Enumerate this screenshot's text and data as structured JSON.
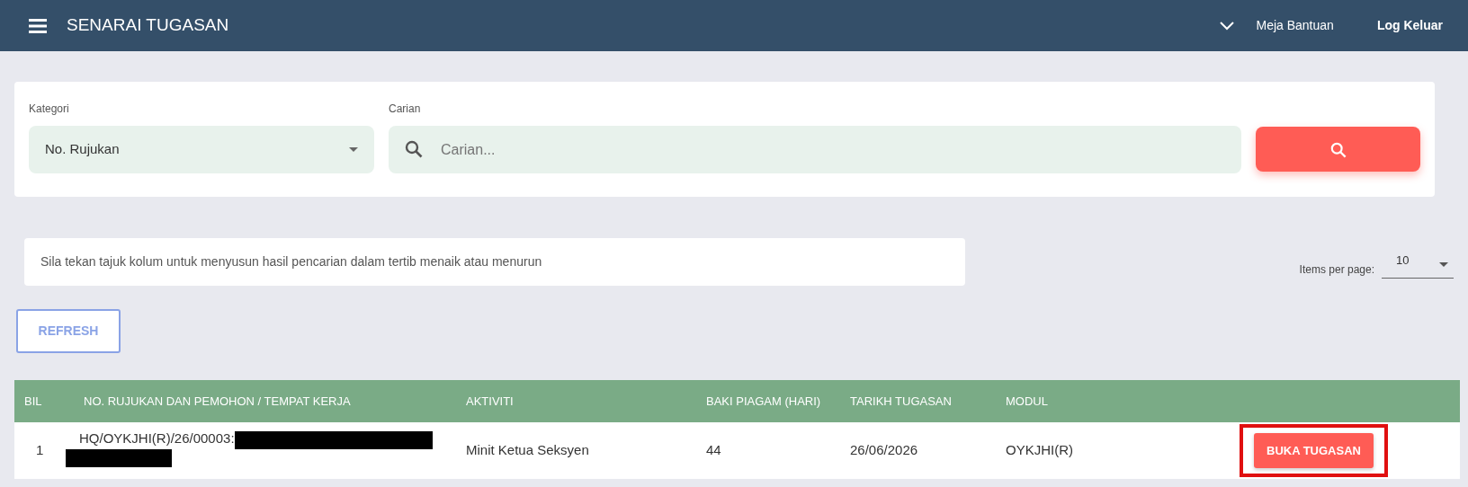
{
  "navbar": {
    "title": "SENARAI TUGASAN",
    "links": [
      "Meja Bantuan",
      "Log Keluar"
    ]
  },
  "filter": {
    "category_label": "Kategori",
    "category_value": "No. Rujukan",
    "search_label": "Carian",
    "search_placeholder": "Carian..."
  },
  "hint": "Sila tekan tajuk kolum untuk menyusun hasil pencarian dalam tertib menaik atau menurun",
  "items_per_page": {
    "label": "Items per page:",
    "value": "10"
  },
  "refresh_button": "REFRESH",
  "table": {
    "columns": [
      "BIL",
      "NO. RUJUKAN DAN PEMOHON / TEMPAT KERJA",
      "AKTIVITI",
      "BAKI PIAGAM (HARI)",
      "TARIKH TUGASAN",
      "MODUL"
    ],
    "rows": [
      {
        "bil": "1",
        "reference": "HQ/OYKJHI(R)/26/00003:",
        "redacted": true,
        "activity": "Minit Ketua Seksyen",
        "days": "44",
        "date": "26/06/2026",
        "module": "OYKJHI(R)",
        "action": "BUKA TUGASAN",
        "highlighted": true
      }
    ]
  }
}
